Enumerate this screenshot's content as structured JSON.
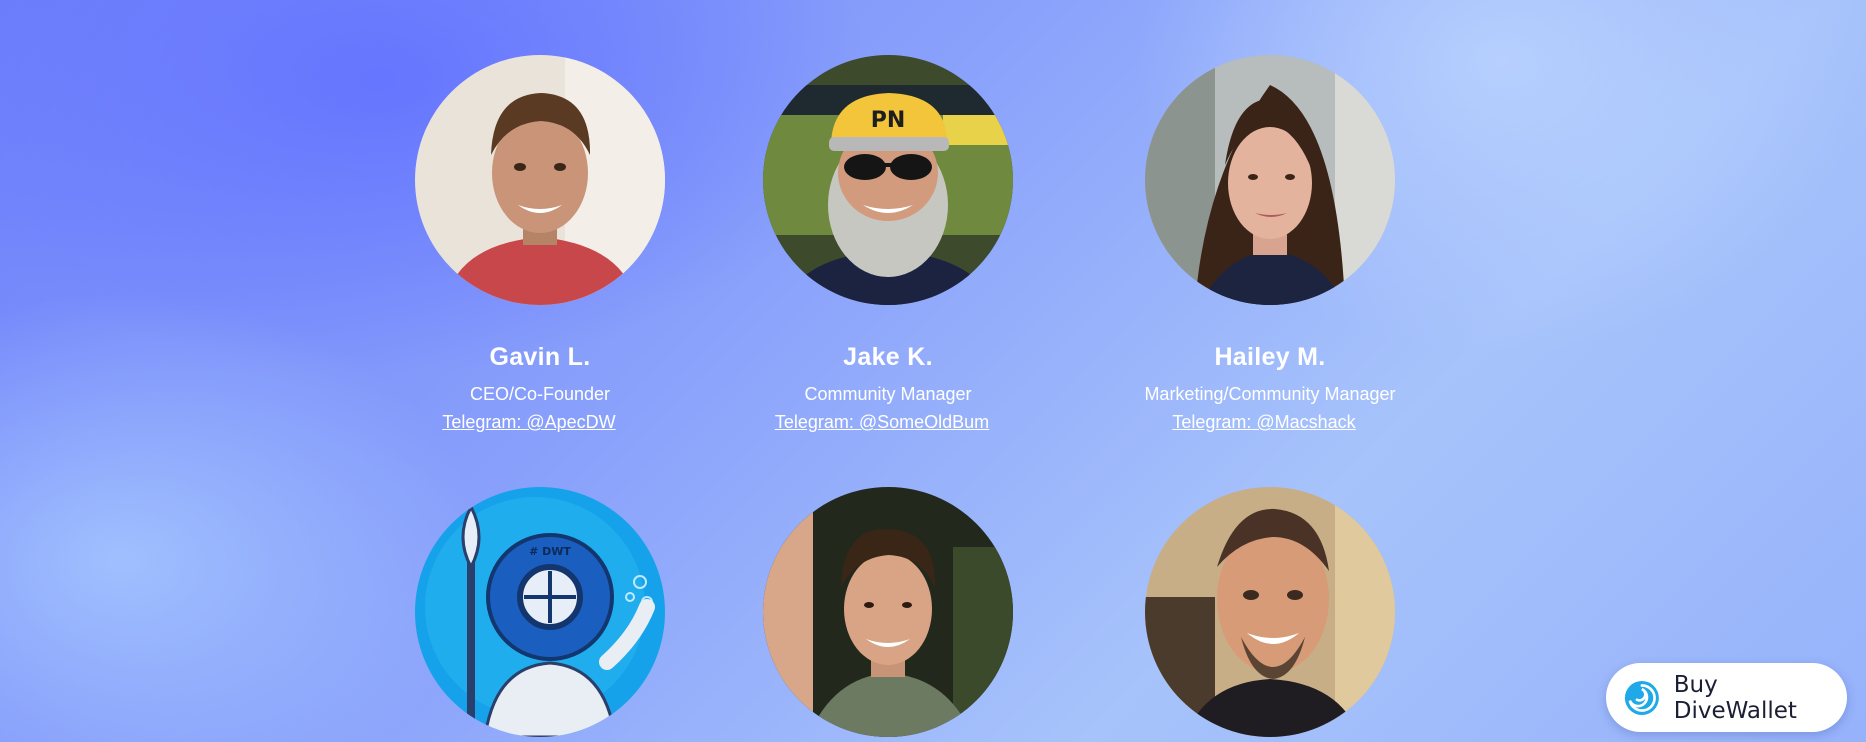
{
  "team": [
    {
      "name": "Gavin L.",
      "role": "CEO/Co-Founder",
      "telegram": "Telegram: @ApecDW"
    },
    {
      "name": "Jake K.",
      "role": "Community Manager",
      "telegram": "Telegram: @SomeOldBum"
    },
    {
      "name": "Hailey M.",
      "role": "Marketing/Community Manager",
      "telegram": "Telegram: @Macshack"
    }
  ],
  "diver_badge": "# DWT",
  "buy_button": {
    "label": "Buy DiveWallet",
    "icon": "divewallet-swirl-logo"
  },
  "colors": {
    "accent": "#1fa9e8",
    "text": "#ffffff",
    "button_text": "#1b1f33"
  }
}
